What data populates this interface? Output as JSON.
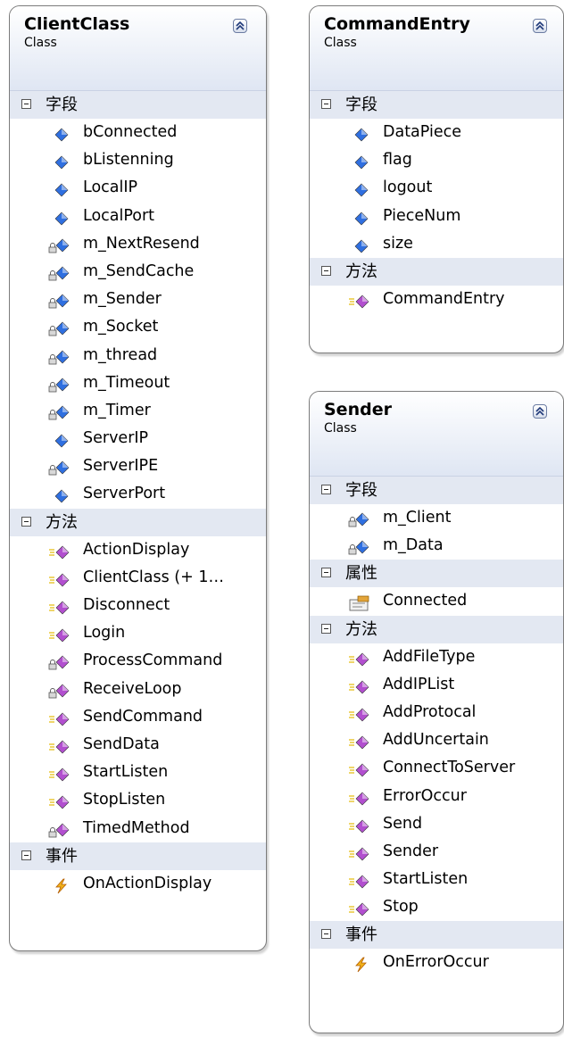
{
  "classes": [
    {
      "name": "ClientClass",
      "kind": "Class",
      "sections": [
        {
          "title": "字段",
          "kind": "fields",
          "items": [
            {
              "name": "bConnected",
              "icon": "field-icon"
            },
            {
              "name": "bListenning",
              "icon": "field-icon"
            },
            {
              "name": "LocalIP",
              "icon": "field-icon"
            },
            {
              "name": "LocalPort",
              "icon": "field-icon"
            },
            {
              "name": "m_NextResend",
              "icon": "private-field-icon"
            },
            {
              "name": "m_SendCache",
              "icon": "private-field-icon"
            },
            {
              "name": "m_Sender",
              "icon": "private-field-icon"
            },
            {
              "name": "m_Socket",
              "icon": "private-field-icon"
            },
            {
              "name": "m_thread",
              "icon": "private-field-icon"
            },
            {
              "name": "m_Timeout",
              "icon": "private-field-icon"
            },
            {
              "name": "m_Timer",
              "icon": "private-field-icon"
            },
            {
              "name": "ServerIP",
              "icon": "field-icon"
            },
            {
              "name": "ServerIPE",
              "icon": "private-field-icon"
            },
            {
              "name": "ServerPort",
              "icon": "field-icon"
            }
          ]
        },
        {
          "title": "方法",
          "kind": "methods",
          "items": [
            {
              "name": "ActionDisplay",
              "icon": "method-icon"
            },
            {
              "name": "ClientClass (+ 1…",
              "icon": "method-icon"
            },
            {
              "name": "Disconnect",
              "icon": "method-icon"
            },
            {
              "name": "Login",
              "icon": "method-icon"
            },
            {
              "name": "ProcessCommand",
              "icon": "private-method-icon"
            },
            {
              "name": "ReceiveLoop",
              "icon": "private-method-icon"
            },
            {
              "name": "SendCommand",
              "icon": "method-icon"
            },
            {
              "name": "SendData",
              "icon": "method-icon"
            },
            {
              "name": "StartListen",
              "icon": "method-icon"
            },
            {
              "name": "StopListen",
              "icon": "method-icon"
            },
            {
              "name": "TimedMethod",
              "icon": "private-method-icon"
            }
          ]
        },
        {
          "title": "事件",
          "kind": "events",
          "items": [
            {
              "name": "OnActionDisplay",
              "icon": "event-icon"
            }
          ]
        }
      ]
    },
    {
      "name": "CommandEntry",
      "kind": "Class",
      "sections": [
        {
          "title": "字段",
          "kind": "fields",
          "items": [
            {
              "name": "DataPiece",
              "icon": "field-icon"
            },
            {
              "name": "flag",
              "icon": "field-icon"
            },
            {
              "name": "logout",
              "icon": "field-icon"
            },
            {
              "name": "PieceNum",
              "icon": "field-icon"
            },
            {
              "name": "size",
              "icon": "field-icon"
            }
          ]
        },
        {
          "title": "方法",
          "kind": "methods",
          "items": [
            {
              "name": "CommandEntry",
              "icon": "method-icon"
            }
          ]
        }
      ]
    },
    {
      "name": "Sender",
      "kind": "Class",
      "sections": [
        {
          "title": "字段",
          "kind": "fields",
          "items": [
            {
              "name": "m_Client",
              "icon": "private-field-icon"
            },
            {
              "name": "m_Data",
              "icon": "private-field-icon"
            }
          ]
        },
        {
          "title": "属性",
          "kind": "properties",
          "items": [
            {
              "name": "Connected",
              "icon": "property-icon"
            }
          ]
        },
        {
          "title": "方法",
          "kind": "methods",
          "items": [
            {
              "name": "AddFileType",
              "icon": "method-icon"
            },
            {
              "name": "AddIPList",
              "icon": "method-icon"
            },
            {
              "name": "AddProtocal",
              "icon": "method-icon"
            },
            {
              "name": "AddUncertain",
              "icon": "method-icon"
            },
            {
              "name": "ConnectToServer",
              "icon": "method-icon"
            },
            {
              "name": "ErrorOccur",
              "icon": "method-icon"
            },
            {
              "name": "Send",
              "icon": "method-icon"
            },
            {
              "name": "Sender",
              "icon": "method-icon"
            },
            {
              "name": "StartListen",
              "icon": "method-icon"
            },
            {
              "name": "Stop",
              "icon": "method-icon"
            }
          ]
        },
        {
          "title": "事件",
          "kind": "events",
          "items": [
            {
              "name": "OnErrorOccur",
              "icon": "event-icon"
            }
          ]
        }
      ]
    }
  ],
  "colors": {
    "field": "#2f6fe0",
    "method": "#b24fcf",
    "event": "#f2b31a",
    "border": "#7b7b7b",
    "section_bg": "#e3e8f2"
  }
}
